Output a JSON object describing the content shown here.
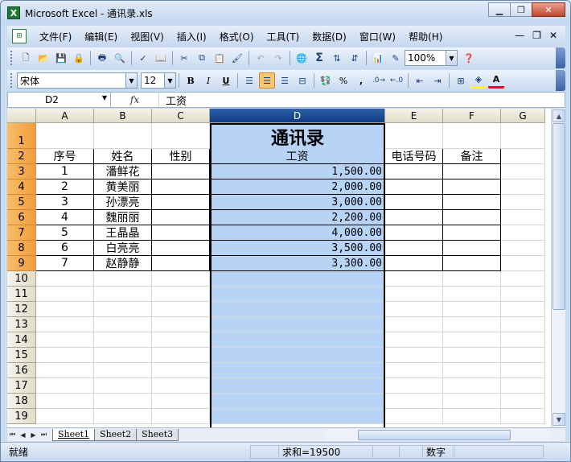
{
  "window": {
    "title": "Microsoft Excel - 通讯录.xls",
    "app_icon": "excel-icon",
    "controls": [
      "minimize-icon",
      "restore-icon",
      "close-icon"
    ]
  },
  "menubar": {
    "items": [
      "文件(F)",
      "编辑(E)",
      "视图(V)",
      "插入(I)",
      "格式(O)",
      "工具(T)",
      "数据(D)",
      "窗口(W)",
      "帮助(H)"
    ],
    "right": [
      "-",
      "ㅁ",
      "x"
    ]
  },
  "toolbar_standard": {
    "zoom": "100%"
  },
  "toolbar_format": {
    "font": "宋体",
    "size": "12",
    "bold": "B",
    "italic": "I",
    "underline": "U",
    "percent": "%",
    "comma": ","
  },
  "formula_bar": {
    "name_box": "D2",
    "fx": "fx",
    "value": "工资"
  },
  "sheet": {
    "columns": [
      "A",
      "B",
      "C",
      "D",
      "E",
      "F",
      "G"
    ],
    "rows": [
      "1",
      "2",
      "3",
      "4",
      "5",
      "6",
      "7",
      "8",
      "9",
      "10",
      "11",
      "12",
      "13",
      "14",
      "15",
      "16",
      "17",
      "18",
      "19"
    ],
    "title": "通讯录",
    "headers": [
      "序号",
      "姓名",
      "性别",
      "工资",
      "电话号码",
      "备注"
    ],
    "data": [
      [
        "1",
        "潘鲜花",
        "",
        "1,500.00",
        "",
        ""
      ],
      [
        "2",
        "黄美丽",
        "",
        "2,000.00",
        "",
        ""
      ],
      [
        "3",
        "孙漂亮",
        "",
        "3,000.00",
        "",
        ""
      ],
      [
        "4",
        "魏丽丽",
        "",
        "2,200.00",
        "",
        ""
      ],
      [
        "5",
        "王晶晶",
        "",
        "4,000.00",
        "",
        ""
      ],
      [
        "6",
        "白亮亮",
        "",
        "3,500.00",
        "",
        ""
      ],
      [
        "7",
        "赵静静",
        "",
        "3,300.00",
        "",
        ""
      ]
    ]
  },
  "tabs": [
    "Sheet1",
    "Sheet2",
    "Sheet3"
  ],
  "statusbar": {
    "ready": "就绪",
    "sum": "求和=19500",
    "numlock": "数字"
  },
  "colors": {
    "selection": "#b7d4f7",
    "selected_header": "#0e3c86",
    "row_header_highlight": "#f39c3a"
  }
}
